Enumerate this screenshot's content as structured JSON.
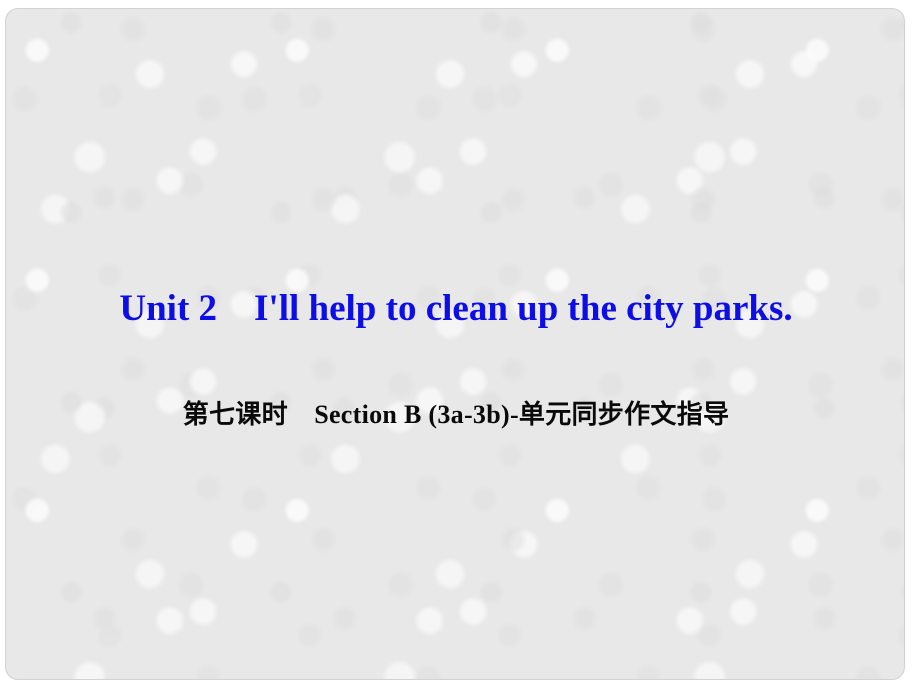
{
  "slide": {
    "background_color": "#e8e8e8",
    "border_color": "#d2d2d2",
    "title": {
      "text": "Unit 2　I'll help to clean up the city parks.",
      "color": "#0d0de8"
    },
    "subtitle": {
      "text": "第七课时　Section B (3a-3b)-单元同步作文指导",
      "color": "#0a0a0a"
    }
  }
}
